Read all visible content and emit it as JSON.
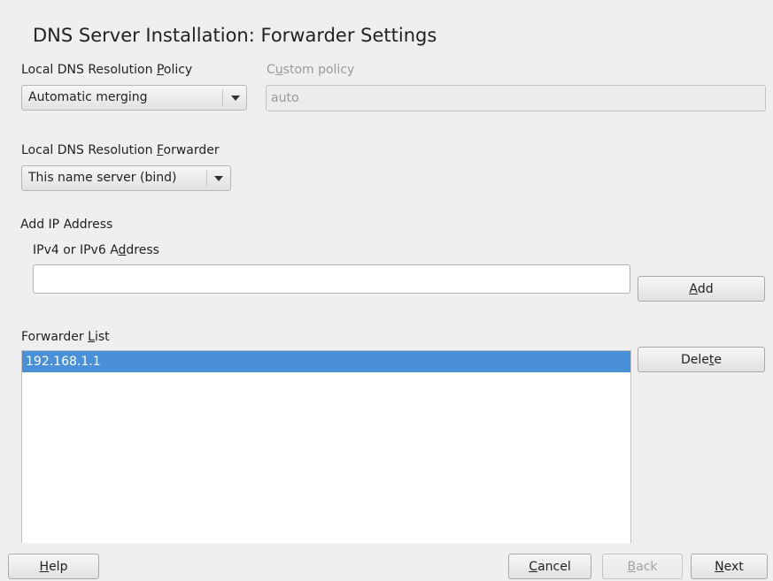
{
  "page": {
    "title": "DNS Server Installation: Forwarder Settings"
  },
  "policy": {
    "label_prefix": "Local DNS Resolution ",
    "label_accel": "P",
    "label_suffix": "olicy",
    "selected": "Automatic merging"
  },
  "custom_policy": {
    "label_prefix": "C",
    "label_accel": "u",
    "label_suffix": "stom policy",
    "value": "auto",
    "enabled": false
  },
  "forwarder": {
    "label_prefix": "Local DNS Resolution ",
    "label_accel": "F",
    "label_suffix": "orwarder",
    "selected": "This name server (bind)"
  },
  "add_ip": {
    "heading": "Add IP Address",
    "field_label_prefix": "IPv4 or IPv6 A",
    "field_label_accel": "d",
    "field_label_suffix": "dress",
    "value": "",
    "add_button": {
      "accel": "A",
      "rest": "dd"
    }
  },
  "forwarder_list": {
    "label_prefix": "Forwarder ",
    "label_accel": "L",
    "label_suffix": "ist",
    "items": [
      "192.168.1.1"
    ],
    "selected_index": 0,
    "delete_button": {
      "prefix": "Dele",
      "accel": "t",
      "suffix": "e"
    }
  },
  "footer": {
    "help": {
      "accel": "H",
      "rest": "elp"
    },
    "cancel": {
      "accel": "C",
      "rest": "ancel"
    },
    "back": {
      "accel": "B",
      "rest": "ack",
      "enabled": false
    },
    "next": {
      "accel": "N",
      "rest": "ext"
    }
  },
  "colors": {
    "window_bg": "#efefef",
    "selection": "#4a90d9",
    "disabled_text": "#9a9a9a"
  }
}
